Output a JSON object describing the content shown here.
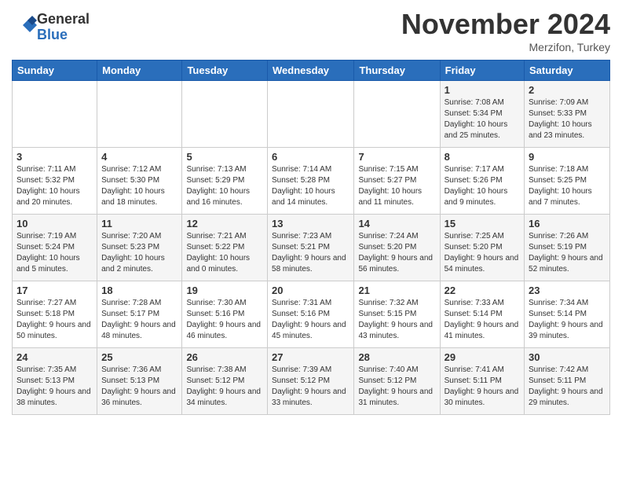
{
  "header": {
    "logo_line1": "General",
    "logo_line2": "Blue",
    "month": "November 2024",
    "location": "Merzifon, Turkey"
  },
  "weekdays": [
    "Sunday",
    "Monday",
    "Tuesday",
    "Wednesday",
    "Thursday",
    "Friday",
    "Saturday"
  ],
  "weeks": [
    [
      {
        "day": "",
        "info": ""
      },
      {
        "day": "",
        "info": ""
      },
      {
        "day": "",
        "info": ""
      },
      {
        "day": "",
        "info": ""
      },
      {
        "day": "",
        "info": ""
      },
      {
        "day": "1",
        "info": "Sunrise: 7:08 AM\nSunset: 5:34 PM\nDaylight: 10 hours and 25 minutes."
      },
      {
        "day": "2",
        "info": "Sunrise: 7:09 AM\nSunset: 5:33 PM\nDaylight: 10 hours and 23 minutes."
      }
    ],
    [
      {
        "day": "3",
        "info": "Sunrise: 7:11 AM\nSunset: 5:32 PM\nDaylight: 10 hours and 20 minutes."
      },
      {
        "day": "4",
        "info": "Sunrise: 7:12 AM\nSunset: 5:30 PM\nDaylight: 10 hours and 18 minutes."
      },
      {
        "day": "5",
        "info": "Sunrise: 7:13 AM\nSunset: 5:29 PM\nDaylight: 10 hours and 16 minutes."
      },
      {
        "day": "6",
        "info": "Sunrise: 7:14 AM\nSunset: 5:28 PM\nDaylight: 10 hours and 14 minutes."
      },
      {
        "day": "7",
        "info": "Sunrise: 7:15 AM\nSunset: 5:27 PM\nDaylight: 10 hours and 11 minutes."
      },
      {
        "day": "8",
        "info": "Sunrise: 7:17 AM\nSunset: 5:26 PM\nDaylight: 10 hours and 9 minutes."
      },
      {
        "day": "9",
        "info": "Sunrise: 7:18 AM\nSunset: 5:25 PM\nDaylight: 10 hours and 7 minutes."
      }
    ],
    [
      {
        "day": "10",
        "info": "Sunrise: 7:19 AM\nSunset: 5:24 PM\nDaylight: 10 hours and 5 minutes."
      },
      {
        "day": "11",
        "info": "Sunrise: 7:20 AM\nSunset: 5:23 PM\nDaylight: 10 hours and 2 minutes."
      },
      {
        "day": "12",
        "info": "Sunrise: 7:21 AM\nSunset: 5:22 PM\nDaylight: 10 hours and 0 minutes."
      },
      {
        "day": "13",
        "info": "Sunrise: 7:23 AM\nSunset: 5:21 PM\nDaylight: 9 hours and 58 minutes."
      },
      {
        "day": "14",
        "info": "Sunrise: 7:24 AM\nSunset: 5:20 PM\nDaylight: 9 hours and 56 minutes."
      },
      {
        "day": "15",
        "info": "Sunrise: 7:25 AM\nSunset: 5:20 PM\nDaylight: 9 hours and 54 minutes."
      },
      {
        "day": "16",
        "info": "Sunrise: 7:26 AM\nSunset: 5:19 PM\nDaylight: 9 hours and 52 minutes."
      }
    ],
    [
      {
        "day": "17",
        "info": "Sunrise: 7:27 AM\nSunset: 5:18 PM\nDaylight: 9 hours and 50 minutes."
      },
      {
        "day": "18",
        "info": "Sunrise: 7:28 AM\nSunset: 5:17 PM\nDaylight: 9 hours and 48 minutes."
      },
      {
        "day": "19",
        "info": "Sunrise: 7:30 AM\nSunset: 5:16 PM\nDaylight: 9 hours and 46 minutes."
      },
      {
        "day": "20",
        "info": "Sunrise: 7:31 AM\nSunset: 5:16 PM\nDaylight: 9 hours and 45 minutes."
      },
      {
        "day": "21",
        "info": "Sunrise: 7:32 AM\nSunset: 5:15 PM\nDaylight: 9 hours and 43 minutes."
      },
      {
        "day": "22",
        "info": "Sunrise: 7:33 AM\nSunset: 5:14 PM\nDaylight: 9 hours and 41 minutes."
      },
      {
        "day": "23",
        "info": "Sunrise: 7:34 AM\nSunset: 5:14 PM\nDaylight: 9 hours and 39 minutes."
      }
    ],
    [
      {
        "day": "24",
        "info": "Sunrise: 7:35 AM\nSunset: 5:13 PM\nDaylight: 9 hours and 38 minutes."
      },
      {
        "day": "25",
        "info": "Sunrise: 7:36 AM\nSunset: 5:13 PM\nDaylight: 9 hours and 36 minutes."
      },
      {
        "day": "26",
        "info": "Sunrise: 7:38 AM\nSunset: 5:12 PM\nDaylight: 9 hours and 34 minutes."
      },
      {
        "day": "27",
        "info": "Sunrise: 7:39 AM\nSunset: 5:12 PM\nDaylight: 9 hours and 33 minutes."
      },
      {
        "day": "28",
        "info": "Sunrise: 7:40 AM\nSunset: 5:12 PM\nDaylight: 9 hours and 31 minutes."
      },
      {
        "day": "29",
        "info": "Sunrise: 7:41 AM\nSunset: 5:11 PM\nDaylight: 9 hours and 30 minutes."
      },
      {
        "day": "30",
        "info": "Sunrise: 7:42 AM\nSunset: 5:11 PM\nDaylight: 9 hours and 29 minutes."
      }
    ]
  ]
}
